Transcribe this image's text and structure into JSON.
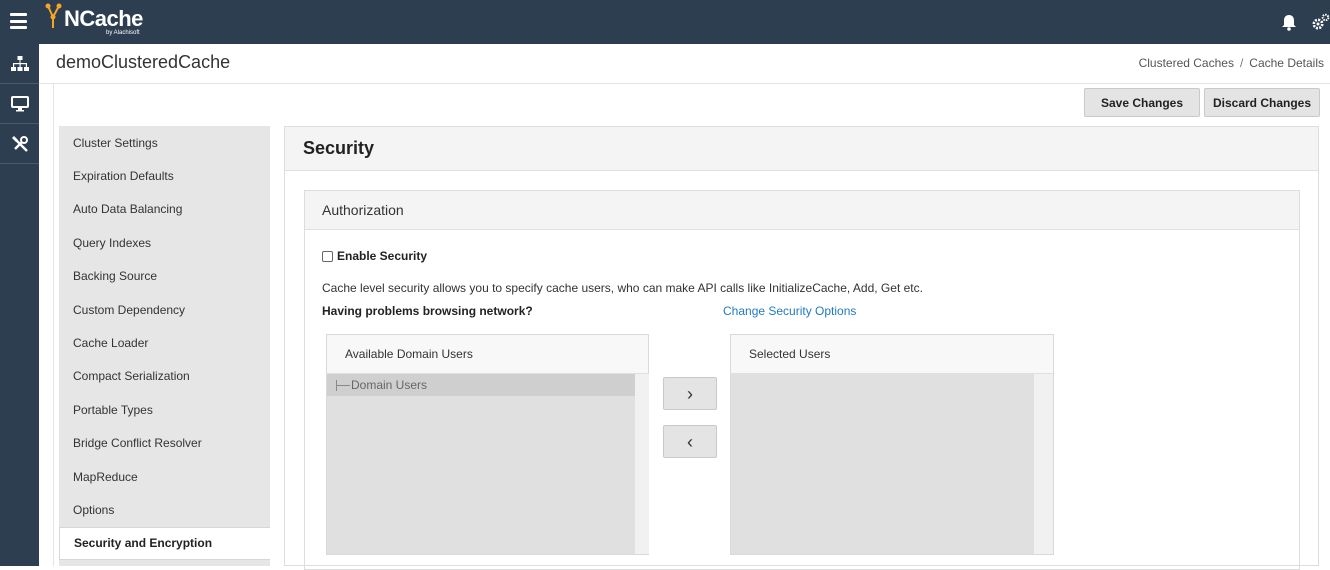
{
  "app": {
    "name": "NCache",
    "vendor": "by Alachisoft"
  },
  "header": {
    "title": "demoClusteredCache",
    "breadcrumb": [
      "Clustered Caches",
      "Cache Details"
    ],
    "breadcrumb_sep": "/"
  },
  "toolbar": {
    "save_label": "Save Changes",
    "discard_label": "Discard Changes"
  },
  "sidemenu": {
    "items": [
      {
        "label": "Cluster Settings"
      },
      {
        "label": "Expiration Defaults"
      },
      {
        "label": "Auto Data Balancing"
      },
      {
        "label": "Query Indexes"
      },
      {
        "label": "Backing Source"
      },
      {
        "label": "Custom Dependency"
      },
      {
        "label": "Cache Loader"
      },
      {
        "label": "Compact Serialization"
      },
      {
        "label": "Portable Types"
      },
      {
        "label": "Bridge Conflict Resolver"
      },
      {
        "label": "MapReduce"
      },
      {
        "label": "Options"
      },
      {
        "label": "Security and Encryption",
        "active": true
      }
    ]
  },
  "security": {
    "title": "Security",
    "authorization": {
      "title": "Authorization",
      "enable_label": "Enable Security",
      "enable_checked": false,
      "description": "Cache level security allows you to specify cache users, who can make API calls like InitializeCache, Add, Get etc.",
      "problems_label": "Having problems browsing network?",
      "change_link": "Change Security Options",
      "available": {
        "title": "Available Domain Users",
        "items": [
          "Domain Users"
        ]
      },
      "selected": {
        "title": "Selected Users",
        "items": []
      },
      "add_arrow": "›",
      "remove_arrow": "‹"
    }
  },
  "colors": {
    "topbar": "#2c3e50",
    "link": "#1f7bc1",
    "logo_accent": "#f5a623"
  },
  "icons": {
    "menu": "hamburger-icon",
    "bell": "bell-icon",
    "settings": "gears-icon",
    "nav": [
      "sitemap-icon",
      "monitor-icon",
      "tools-icon"
    ]
  }
}
